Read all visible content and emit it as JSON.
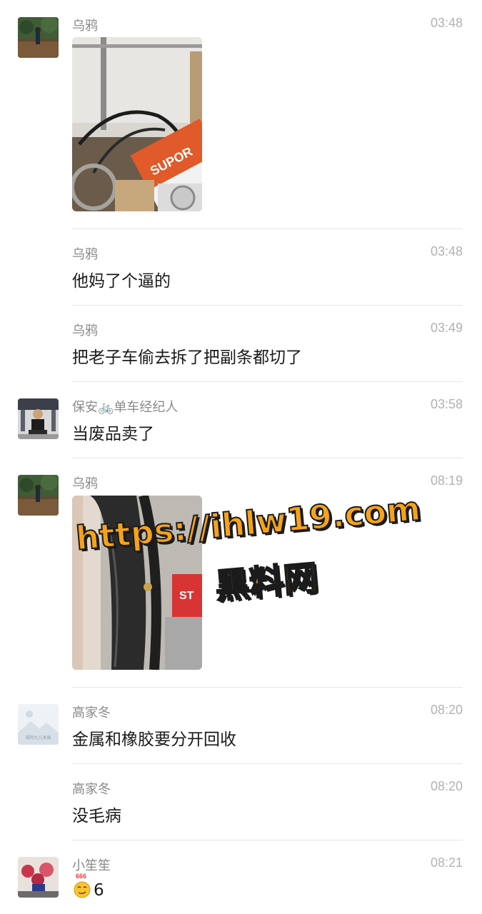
{
  "messages": [
    {
      "sender": "乌鸦",
      "time": "03:48",
      "type": "image"
    },
    {
      "sender": "乌鸦",
      "time": "03:48",
      "text": "他妈了个逼的"
    },
    {
      "sender": "乌鸦",
      "time": "03:49",
      "text": "把老子车偷去拆了把副条都切了"
    },
    {
      "sender": "保安🚲单车经纪人",
      "time": "03:58",
      "text": "当废品卖了"
    },
    {
      "sender": "乌鸦",
      "time": "08:19",
      "type": "image"
    },
    {
      "sender": "高家冬",
      "time": "08:20",
      "text": "金属和橡胶要分开回收"
    },
    {
      "sender": "高家冬",
      "time": "08:20",
      "text": "没毛病"
    },
    {
      "sender": "小笙笙",
      "time": "08:21",
      "emoji_badge": "666",
      "text": "6"
    }
  ],
  "photo1": {
    "brand_text": "SUPOR"
  },
  "photo2": {
    "brand_text": "ST"
  },
  "watermark": {
    "line1": "https://ihlw19.com",
    "line2": "黑料网",
    "color": "#f6a31a"
  },
  "placeholder_avatar": {
    "caption": "福利九儿发展"
  }
}
